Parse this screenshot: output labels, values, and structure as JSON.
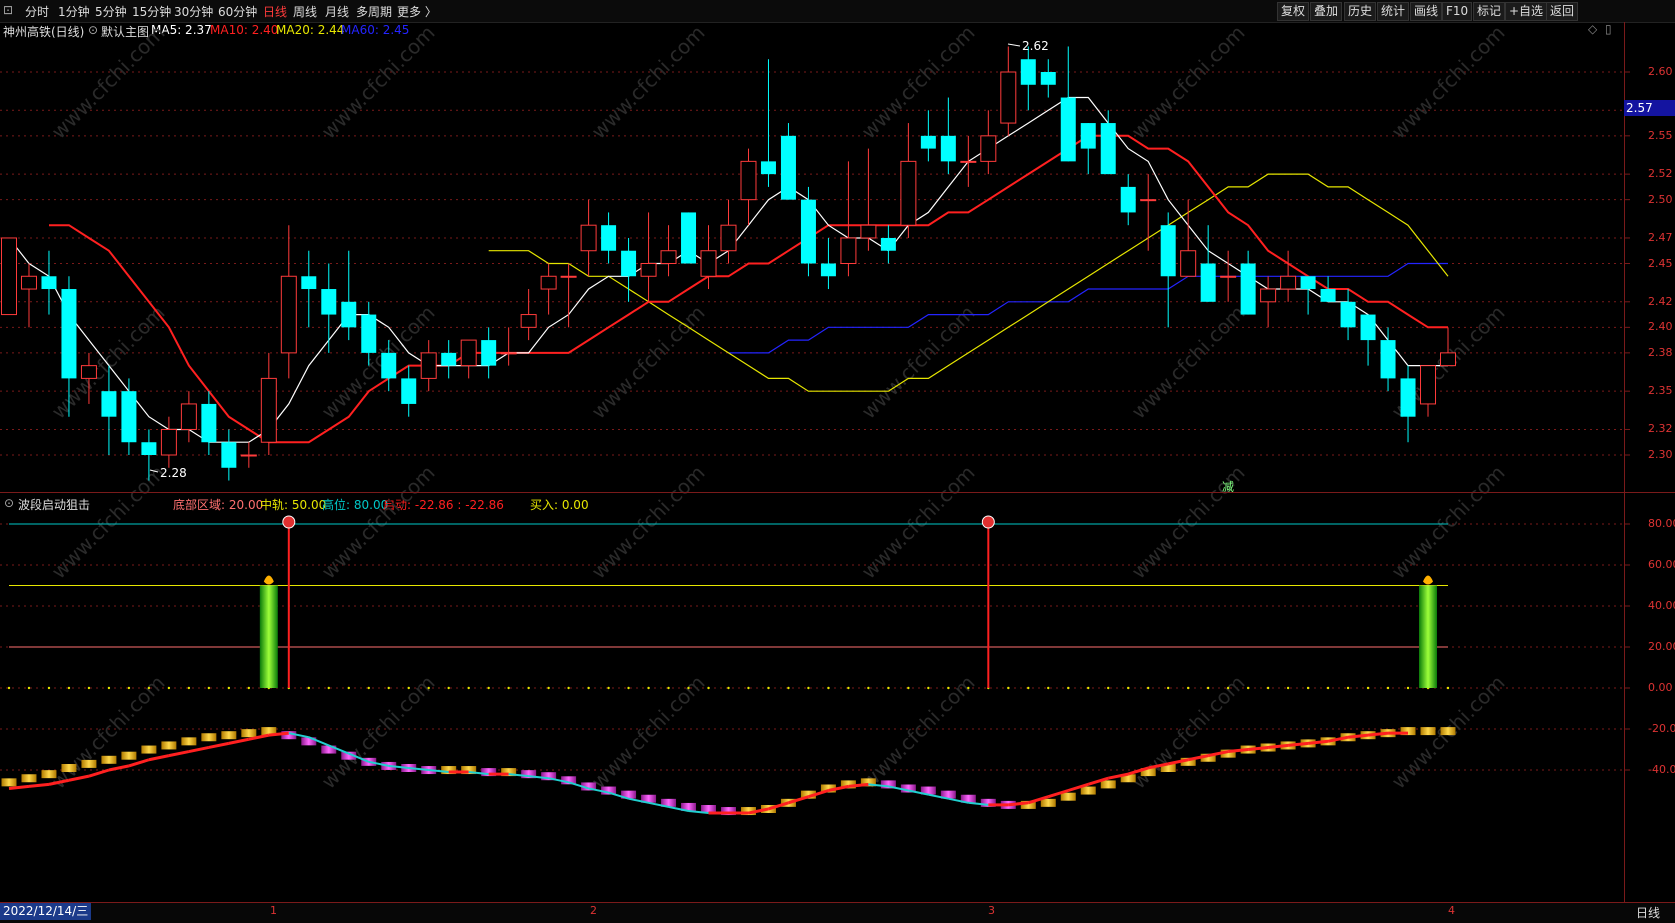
{
  "topbar": {
    "logo": "⊡",
    "periods": [
      "分时",
      "1分钟",
      "5分钟",
      "15分钟",
      "30分钟",
      "60分钟",
      "日线",
      "周线",
      "月线",
      "多周期",
      "更多 〉"
    ],
    "active_period": "日线",
    "right_buttons": [
      "复权",
      "叠加",
      "历史",
      "统计",
      "画线",
      "F10",
      "标记",
      "+自选",
      "返回"
    ]
  },
  "main_panel": {
    "stock_title": "神州高铁(日线)",
    "indicator_name": "默认主图",
    "ma_legend": [
      {
        "label": "MA5: 2.37",
        "color": "#ffffff"
      },
      {
        "label": "MA10: 2.40",
        "color": "#ff2020"
      },
      {
        "label": "MA20: 2.44",
        "color": "#e6e600"
      },
      {
        "label": "MA60: 2.45",
        "color": "#2424ff"
      }
    ],
    "current_price": "2.57",
    "high_label": "2.62",
    "low_label": "2.28",
    "signal_char": "减",
    "y_ticks": [
      "2.60",
      "2.57",
      "2.55",
      "2.52",
      "2.50",
      "2.47",
      "2.45",
      "2.42",
      "2.40",
      "2.38",
      "2.35",
      "2.32",
      "2.30"
    ]
  },
  "sub_panel": {
    "indicator_name": "波段启动狙击",
    "legend": [
      {
        "label": "底部区域: 20.00",
        "color": "#ff7070"
      },
      {
        "label": "中轨: 50.00",
        "color": "#e6e600"
      },
      {
        "label": "高位: 80.00",
        "color": "#00c8c8"
      },
      {
        "label": "启动: -22.86 : -22.86",
        "color": "#ff2020"
      },
      {
        "label": "买入: 0.00",
        "color": "#e6e600"
      }
    ],
    "y_ticks": [
      "80.00",
      "60.00",
      "40.00",
      "20.00",
      "0.00",
      "-20.00",
      "-40.00"
    ]
  },
  "bottombar": {
    "date": "2022/12/14/三",
    "month_marks": [
      "1",
      "2",
      "3",
      "4"
    ],
    "period_label": "日线"
  },
  "watermark": "www.cfchi.com",
  "colors": {
    "up": "#ff3b3b",
    "down": "#00ffff",
    "ma5": "#ffffff",
    "ma10": "#ff2020",
    "ma20": "#e6e600",
    "ma60": "#2424ff",
    "grid": "#7a1a1a",
    "osc_up": "#f0b400",
    "osc_down": "#d22fd2"
  },
  "chart_data": {
    "type": "candlestick",
    "candles": [
      {
        "o": 2.41,
        "c": 2.47,
        "h": 2.47,
        "l": 2.41
      },
      {
        "o": 2.43,
        "c": 2.44,
        "h": 2.45,
        "l": 2.4
      },
      {
        "o": 2.44,
        "c": 2.43,
        "h": 2.46,
        "l": 2.41
      },
      {
        "o": 2.43,
        "c": 2.36,
        "h": 2.44,
        "l": 2.33
      },
      {
        "o": 2.36,
        "c": 2.37,
        "h": 2.38,
        "l": 2.34
      },
      {
        "o": 2.35,
        "c": 2.33,
        "h": 2.37,
        "l": 2.3
      },
      {
        "o": 2.35,
        "c": 2.31,
        "h": 2.36,
        "l": 2.3
      },
      {
        "o": 2.31,
        "c": 2.3,
        "h": 2.32,
        "l": 2.28
      },
      {
        "o": 2.3,
        "c": 2.32,
        "h": 2.33,
        "l": 2.29
      },
      {
        "o": 2.32,
        "c": 2.34,
        "h": 2.35,
        "l": 2.31
      },
      {
        "o": 2.34,
        "c": 2.31,
        "h": 2.35,
        "l": 2.3
      },
      {
        "o": 2.31,
        "c": 2.29,
        "h": 2.32,
        "l": 2.28
      },
      {
        "o": 2.3,
        "c": 2.3,
        "h": 2.31,
        "l": 2.29
      },
      {
        "o": 2.31,
        "c": 2.36,
        "h": 2.38,
        "l": 2.3
      },
      {
        "o": 2.38,
        "c": 2.44,
        "h": 2.48,
        "l": 2.36
      },
      {
        "o": 2.44,
        "c": 2.43,
        "h": 2.46,
        "l": 2.4
      },
      {
        "o": 2.43,
        "c": 2.41,
        "h": 2.45,
        "l": 2.38
      },
      {
        "o": 2.42,
        "c": 2.4,
        "h": 2.46,
        "l": 2.39
      },
      {
        "o": 2.41,
        "c": 2.38,
        "h": 2.42,
        "l": 2.37
      },
      {
        "o": 2.38,
        "c": 2.36,
        "h": 2.39,
        "l": 2.35
      },
      {
        "o": 2.36,
        "c": 2.34,
        "h": 2.37,
        "l": 2.33
      },
      {
        "o": 2.36,
        "c": 2.38,
        "h": 2.39,
        "l": 2.35
      },
      {
        "o": 2.38,
        "c": 2.37,
        "h": 2.39,
        "l": 2.36
      },
      {
        "o": 2.37,
        "c": 2.39,
        "h": 2.39,
        "l": 2.36
      },
      {
        "o": 2.39,
        "c": 2.37,
        "h": 2.4,
        "l": 2.36
      },
      {
        "o": 2.38,
        "c": 2.38,
        "h": 2.4,
        "l": 2.37
      },
      {
        "o": 2.4,
        "c": 2.41,
        "h": 2.43,
        "l": 2.39
      },
      {
        "o": 2.43,
        "c": 2.44,
        "h": 2.45,
        "l": 2.41
      },
      {
        "o": 2.44,
        "c": 2.44,
        "h": 2.45,
        "l": 2.4
      },
      {
        "o": 2.46,
        "c": 2.48,
        "h": 2.5,
        "l": 2.44
      },
      {
        "o": 2.48,
        "c": 2.46,
        "h": 2.49,
        "l": 2.45
      },
      {
        "o": 2.46,
        "c": 2.44,
        "h": 2.47,
        "l": 2.42
      },
      {
        "o": 2.44,
        "c": 2.45,
        "h": 2.49,
        "l": 2.42
      },
      {
        "o": 2.45,
        "c": 2.46,
        "h": 2.48,
        "l": 2.44
      },
      {
        "o": 2.49,
        "c": 2.45,
        "h": 2.49,
        "l": 2.45
      },
      {
        "o": 2.44,
        "c": 2.46,
        "h": 2.48,
        "l": 2.43
      },
      {
        "o": 2.46,
        "c": 2.48,
        "h": 2.5,
        "l": 2.45
      },
      {
        "o": 2.5,
        "c": 2.53,
        "h": 2.54,
        "l": 2.48
      },
      {
        "o": 2.53,
        "c": 2.52,
        "h": 2.61,
        "l": 2.51
      },
      {
        "o": 2.55,
        "c": 2.5,
        "h": 2.56,
        "l": 2.5
      },
      {
        "o": 2.5,
        "c": 2.45,
        "h": 2.51,
        "l": 2.44
      },
      {
        "o": 2.45,
        "c": 2.44,
        "h": 2.47,
        "l": 2.43
      },
      {
        "o": 2.45,
        "c": 2.47,
        "h": 2.53,
        "l": 2.44
      },
      {
        "o": 2.47,
        "c": 2.48,
        "h": 2.54,
        "l": 2.46
      },
      {
        "o": 2.47,
        "c": 2.46,
        "h": 2.48,
        "l": 2.45
      },
      {
        "o": 2.48,
        "c": 2.53,
        "h": 2.56,
        "l": 2.47
      },
      {
        "o": 2.55,
        "c": 2.54,
        "h": 2.57,
        "l": 2.53
      },
      {
        "o": 2.55,
        "c": 2.53,
        "h": 2.58,
        "l": 2.52
      },
      {
        "o": 2.53,
        "c": 2.53,
        "h": 2.55,
        "l": 2.51
      },
      {
        "o": 2.53,
        "c": 2.55,
        "h": 2.57,
        "l": 2.52
      },
      {
        "o": 2.56,
        "c": 2.6,
        "h": 2.62,
        "l": 2.55
      },
      {
        "o": 2.61,
        "c": 2.59,
        "h": 2.62,
        "l": 2.57
      },
      {
        "o": 2.6,
        "c": 2.59,
        "h": 2.61,
        "l": 2.58
      },
      {
        "o": 2.58,
        "c": 2.53,
        "h": 2.62,
        "l": 2.53
      },
      {
        "o": 2.56,
        "c": 2.54,
        "h": 2.56,
        "l": 2.52
      },
      {
        "o": 2.56,
        "c": 2.52,
        "h": 2.57,
        "l": 2.52
      },
      {
        "o": 2.51,
        "c": 2.49,
        "h": 2.52,
        "l": 2.48
      },
      {
        "o": 2.5,
        "c": 2.5,
        "h": 2.52,
        "l": 2.46
      },
      {
        "o": 2.48,
        "c": 2.44,
        "h": 2.49,
        "l": 2.4
      },
      {
        "o": 2.44,
        "c": 2.46,
        "h": 2.5,
        "l": 2.44
      },
      {
        "o": 2.45,
        "c": 2.42,
        "h": 2.48,
        "l": 2.42
      },
      {
        "o": 2.44,
        "c": 2.44,
        "h": 2.46,
        "l": 2.42
      },
      {
        "o": 2.45,
        "c": 2.41,
        "h": 2.46,
        "l": 2.41
      },
      {
        "o": 2.42,
        "c": 2.43,
        "h": 2.44,
        "l": 2.4
      },
      {
        "o": 2.43,
        "c": 2.44,
        "h": 2.46,
        "l": 2.42
      },
      {
        "o": 2.44,
        "c": 2.43,
        "h": 2.44,
        "l": 2.41
      },
      {
        "o": 2.43,
        "c": 2.42,
        "h": 2.44,
        "l": 2.42
      },
      {
        "o": 2.42,
        "c": 2.4,
        "h": 2.43,
        "l": 2.39
      },
      {
        "o": 2.41,
        "c": 2.39,
        "h": 2.41,
        "l": 2.37
      },
      {
        "o": 2.39,
        "c": 2.36,
        "h": 2.4,
        "l": 2.35
      },
      {
        "o": 2.36,
        "c": 2.33,
        "h": 2.37,
        "l": 2.31
      },
      {
        "o": 2.34,
        "c": 2.37,
        "h": 2.37,
        "l": 2.33
      },
      {
        "o": 2.37,
        "c": 2.38,
        "h": 2.4,
        "l": 2.37
      }
    ],
    "ma5": [
      2.47,
      2.45,
      2.44,
      2.41,
      2.39,
      2.37,
      2.35,
      2.33,
      2.32,
      2.32,
      2.31,
      2.31,
      2.31,
      2.32,
      2.34,
      2.37,
      2.39,
      2.41,
      2.41,
      2.4,
      2.38,
      2.37,
      2.37,
      2.37,
      2.37,
      2.38,
      2.38,
      2.4,
      2.41,
      2.43,
      2.44,
      2.44,
      2.45,
      2.45,
      2.46,
      2.45,
      2.46,
      2.48,
      2.5,
      2.51,
      2.5,
      2.48,
      2.47,
      2.47,
      2.46,
      2.48,
      2.49,
      2.51,
      2.53,
      2.54,
      2.55,
      2.56,
      2.57,
      2.58,
      2.58,
      2.56,
      2.54,
      2.53,
      2.5,
      2.48,
      2.46,
      2.45,
      2.44,
      2.43,
      2.43,
      2.43,
      2.42,
      2.42,
      2.41,
      2.39,
      2.37,
      2.37,
      2.37
    ],
    "ma10": [
      2.48,
      2.48,
      2.47,
      2.46,
      2.44,
      2.42,
      2.4,
      2.37,
      2.35,
      2.33,
      2.32,
      2.31,
      2.31,
      2.31,
      2.32,
      2.33,
      2.35,
      2.36,
      2.37,
      2.37,
      2.37,
      2.38,
      2.38,
      2.38,
      2.38,
      2.38,
      2.38,
      2.39,
      2.4,
      2.41,
      2.42,
      2.42,
      2.43,
      2.44,
      2.44,
      2.45,
      2.45,
      2.46,
      2.47,
      2.48,
      2.48,
      2.48,
      2.48,
      2.48,
      2.48,
      2.49,
      2.49,
      2.5,
      2.51,
      2.52,
      2.53,
      2.54,
      2.55,
      2.55,
      2.55,
      2.54,
      2.54,
      2.53,
      2.51,
      2.49,
      2.48,
      2.46,
      2.45,
      2.44,
      2.43,
      2.43,
      2.42,
      2.42,
      2.41,
      2.4,
      2.4
    ],
    "ma20": [
      2.46,
      2.46,
      2.46,
      2.45,
      2.45,
      2.44,
      2.44,
      2.43,
      2.42,
      2.41,
      2.4,
      2.39,
      2.38,
      2.37,
      2.36,
      2.36,
      2.35,
      2.35,
      2.35,
      2.35,
      2.35,
      2.36,
      2.36,
      2.37,
      2.38,
      2.39,
      2.4,
      2.41,
      2.42,
      2.43,
      2.44,
      2.45,
      2.46,
      2.47,
      2.48,
      2.49,
      2.5,
      2.51,
      2.51,
      2.52,
      2.52,
      2.52,
      2.51,
      2.51,
      2.5,
      2.49,
      2.48,
      2.46,
      2.44
    ],
    "ma60": [
      2.38,
      2.38,
      2.38,
      2.39,
      2.39,
      2.4,
      2.4,
      2.4,
      2.4,
      2.4,
      2.41,
      2.41,
      2.41,
      2.41,
      2.42,
      2.42,
      2.42,
      2.42,
      2.43,
      2.43,
      2.43,
      2.43,
      2.43,
      2.44,
      2.44,
      2.44,
      2.44,
      2.44,
      2.44,
      2.44,
      2.44,
      2.44,
      2.44,
      2.44,
      2.45,
      2.45,
      2.45
    ],
    "sub_lines": {
      "bottom": 20,
      "mid": 50,
      "high": 80
    },
    "buy_signals": [
      13,
      71
    ],
    "start_signals": [
      14,
      49
    ],
    "oscillator_bars": [
      -47,
      -45,
      -43,
      -40,
      -38,
      -36,
      -34,
      -31,
      -29,
      -27,
      -25,
      -24,
      -23,
      -22,
      -24,
      -27,
      -31,
      -34,
      -37,
      -39,
      -40,
      -41,
      -41,
      -41,
      -42,
      -42,
      -43,
      -44,
      -46,
      -49,
      -51,
      -53,
      -55,
      -57,
      -59,
      -60,
      -61,
      -61,
      -60,
      -57,
      -53,
      -50,
      -48,
      -47,
      -48,
      -50,
      -51,
      -53,
      -55,
      -57,
      -58,
      -58,
      -57,
      -54,
      -51,
      -48,
      -45,
      -42,
      -40,
      -37,
      -35,
      -33,
      -31,
      -30,
      -29,
      -28,
      -27,
      -25,
      -24,
      -23,
      -22,
      -22,
      -22
    ],
    "oscillator_line": [
      -49,
      -48,
      -47,
      -45,
      -43,
      -40,
      -38,
      -35,
      -33,
      -31,
      -29,
      -27,
      -25,
      -23,
      -22,
      -24,
      -28,
      -32,
      -36,
      -38,
      -39,
      -40,
      -41,
      -41,
      -42,
      -42,
      -43,
      -44,
      -46,
      -49,
      -51,
      -54,
      -56,
      -58,
      -60,
      -61,
      -61,
      -61,
      -59,
      -56,
      -53,
      -50,
      -48,
      -47,
      -48,
      -50,
      -52,
      -54,
      -56,
      -57,
      -57,
      -56,
      -53,
      -50,
      -47,
      -44,
      -42,
      -39,
      -37,
      -35,
      -33,
      -31,
      -30,
      -29,
      -28,
      -27,
      -26,
      -24,
      -23,
      -22,
      -22
    ]
  }
}
